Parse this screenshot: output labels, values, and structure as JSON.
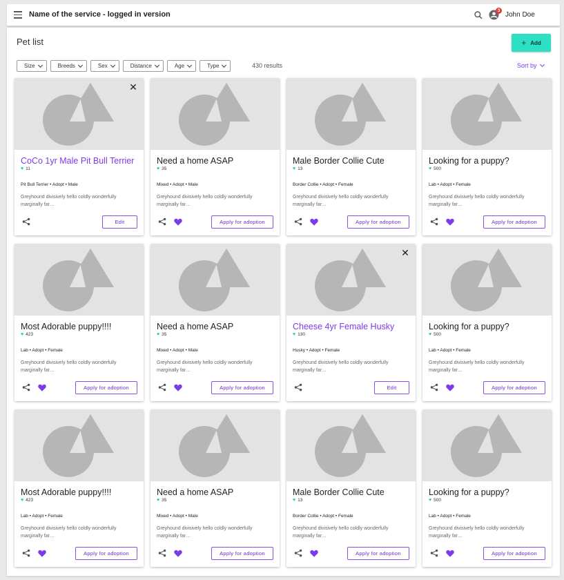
{
  "header": {
    "title": "Name of the service - logged in version",
    "notification_count": "3",
    "user_name": "John Doe"
  },
  "page": {
    "title": "Pet list",
    "add_label": "Add",
    "results": "430 results",
    "sort_label": "Sort by"
  },
  "filters": [
    "Size",
    "Breeds",
    "Sex",
    "Distance",
    "Age",
    "Type"
  ],
  "colors": {
    "accent": "#7c3aed",
    "add_button": "#2de0c4",
    "heart": "#7c3aed",
    "like_heart": "#22c3c3"
  },
  "icons": [
    "menu-icon",
    "search-icon",
    "user-icon",
    "close-icon",
    "share-icon",
    "heart-icon",
    "plus-icon",
    "chevron-down-icon"
  ],
  "cards": [
    {
      "title": "CoCo 1yr Male Pit Bull Terrier",
      "likes": "11",
      "meta": "Pit Bull Terrier • Adopt • Male",
      "desc": "Greyhound divisively hello coldly wonderfully marginally far…",
      "action": "Edit",
      "owner": true
    },
    {
      "title": "Need a home ASAP",
      "likes": "35",
      "meta": "Mixed • Adopt • Male",
      "desc": "Greyhound divisively hello coldly wonderfully marginally far…",
      "action": "Apply for adoption",
      "owner": false
    },
    {
      "title": "Male Border Collie Cute",
      "likes": "13",
      "meta": "Border Collie • Adopt • Female",
      "desc": "Greyhound divisively hello coldly wonderfully marginally far…",
      "action": "Apply for adoption",
      "owner": false
    },
    {
      "title": "Looking for a puppy?",
      "likes": "500",
      "meta": "Lab • Adopt • Female",
      "desc": "Greyhound divisively hello coldly wonderfully marginally far…",
      "action": "Apply for adoption",
      "owner": false
    },
    {
      "title": "Most Adorable puppy!!!!",
      "likes": "423",
      "meta": "Lab • Adopt • Female",
      "desc": "Greyhound divisively hello coldly wonderfully marginally far…",
      "action": "Apply for adoption",
      "owner": false
    },
    {
      "title": "Need a home ASAP",
      "likes": "35",
      "meta": "Mixed • Adopt • Male",
      "desc": "Greyhound divisively hello coldly wonderfully marginally far…",
      "action": "Apply for adoption",
      "owner": false
    },
    {
      "title": "Cheese 4yr Female Husky",
      "likes": "130",
      "meta": "Husky • Adopt • Female",
      "desc": "Greyhound divisively hello coldly wonderfully marginally far…",
      "action": "Edit",
      "owner": true
    },
    {
      "title": "Looking for a puppy?",
      "likes": "500",
      "meta": "Lab • Adopt • Female",
      "desc": "Greyhound divisively hello coldly wonderfully marginally far…",
      "action": "Apply for adoption",
      "owner": false
    },
    {
      "title": "Most Adorable puppy!!!!",
      "likes": "423",
      "meta": "Lab • Adopt • Female",
      "desc": "Greyhound divisively hello coldly wonderfully marginally far…",
      "action": "Apply for adoption",
      "owner": false
    },
    {
      "title": "Need a home ASAP",
      "likes": "35",
      "meta": "Mixed • Adopt • Male",
      "desc": "Greyhound divisively hello coldly wonderfully marginally far…",
      "action": "Apply for adoption",
      "owner": false
    },
    {
      "title": "Male Border Collie Cute",
      "likes": "13",
      "meta": "Border Collie • Adopt • Female",
      "desc": "Greyhound divisively hello coldly wonderfully marginally far…",
      "action": "Apply for adoption",
      "owner": false
    },
    {
      "title": "Looking for a puppy?",
      "likes": "500",
      "meta": "Lab • Adopt • Female",
      "desc": "Greyhound divisively hello coldly wonderfully marginally far…",
      "action": "Apply for adoption",
      "owner": false
    }
  ]
}
